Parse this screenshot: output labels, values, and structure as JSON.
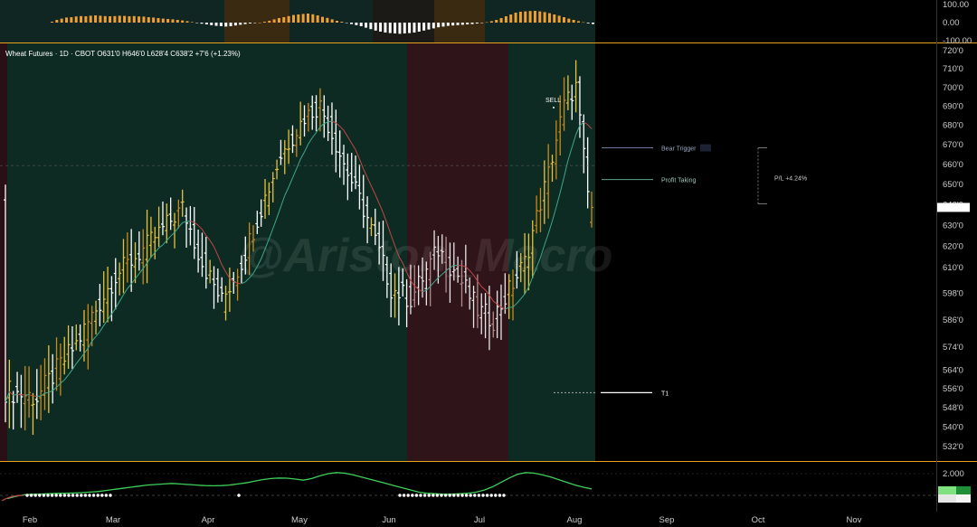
{
  "chart_data": {
    "type": "ohlc",
    "symbol": "Wheat Futures",
    "interval": "1D",
    "exchange": "CBOT",
    "ohlc_labels": {
      "open": "O631'0",
      "high": "H646'0",
      "low": "L628'4",
      "close": "C638'2"
    },
    "change": "+7'6 (+1.23%)",
    "watermark": "@Ariston_Macro",
    "x_months": [
      "Feb",
      "Mar",
      "Apr",
      "May",
      "Jun",
      "Jul",
      "Aug",
      "Sep",
      "Oct",
      "Nov"
    ],
    "price_axis": {
      "ticks": [
        "720'0",
        "710'0",
        "700'0",
        "690'0",
        "680'0",
        "670'0",
        "660'0",
        "650'0",
        "640'0",
        "630'0",
        "620'0",
        "610'0",
        "598'0",
        "586'0",
        "574'0",
        "564'0",
        "556'0",
        "548'0",
        "540'0",
        "532'0"
      ],
      "scale": "log",
      "ylim": [
        528,
        724
      ]
    },
    "top_oscillator": {
      "ticks": [
        "100.00",
        "0.00",
        "-100.00"
      ],
      "ylim": [
        -100,
        100
      ],
      "values": [
        5,
        15,
        22,
        28,
        30,
        34,
        36,
        35,
        38,
        40,
        38,
        36,
        35,
        36,
        38,
        37,
        35,
        36,
        34,
        33,
        30,
        28,
        25,
        22,
        20,
        18,
        15,
        12,
        8,
        3,
        -2,
        -6,
        -10,
        -14,
        -18,
        -20,
        -22,
        -20,
        -16,
        -12,
        -8,
        -5,
        -2,
        0,
        5,
        10,
        18,
        25,
        30,
        36,
        42,
        45,
        48,
        50,
        46,
        40,
        32,
        26,
        18,
        10,
        5,
        -2,
        -8,
        -14,
        -20,
        -28,
        -36,
        -44,
        -50,
        -55,
        -58,
        -60,
        -62,
        -60,
        -58,
        -55,
        -50,
        -44,
        -38,
        -32,
        -26,
        -22,
        -18,
        -16,
        -14,
        -12,
        -10,
        -8,
        -5,
        -2,
        2,
        8,
        15,
        25,
        35,
        45,
        55,
        60,
        62,
        64,
        65,
        62,
        58,
        52,
        45,
        38,
        30,
        22,
        15,
        8,
        2,
        -4,
        -8
      ]
    },
    "bottom_oscillator": {
      "ticks": [
        "2.000"
      ],
      "ylim": [
        -0.6,
        2.6
      ],
      "values": [
        -0.3,
        -0.1,
        0.05,
        0.1,
        0.12,
        0.15,
        0.18,
        0.2,
        0.22,
        0.25,
        0.3,
        0.35,
        0.45,
        0.55,
        0.65,
        0.75,
        0.85,
        0.95,
        1.0,
        1.05,
        1.1,
        1.05,
        1.0,
        0.95,
        0.9,
        0.88,
        0.9,
        0.95,
        1.05,
        1.15,
        1.3,
        1.45,
        1.55,
        1.6,
        1.58,
        1.5,
        1.4,
        1.55,
        1.8,
        2.0,
        2.1,
        2.05,
        1.9,
        1.7,
        1.5,
        1.3,
        1.1,
        0.9,
        0.7,
        0.5,
        0.3,
        0.2,
        0.15,
        0.1,
        0.12,
        0.15,
        0.2,
        0.3,
        0.5,
        0.8,
        1.2,
        1.6,
        1.95,
        2.1,
        2.05,
        1.9,
        1.7,
        1.45,
        1.2,
        0.95,
        0.75,
        0.6
      ]
    },
    "annotations": {
      "sell": "SELL",
      "bear_trigger": "Bear Trigger",
      "profit_taking": "Profit Taking",
      "pl": "P/L +4.24%",
      "target": "T1"
    },
    "levels": {
      "bear_trigger": 668,
      "profit_taking": 652,
      "t1": 554,
      "entry": 640,
      "current": 638.25
    },
    "colors": {
      "bull_zone": "#0d2b22",
      "bear_zone": "#2f1419",
      "bull_bar": "#e8c23a",
      "weak_bar": "#c98a1c",
      "down_bar": "#ffffff",
      "ma_up": "#3fa88a",
      "ma_down": "#c04848",
      "osc_line": "#3ecf58",
      "accent": "#e8a11c"
    }
  }
}
